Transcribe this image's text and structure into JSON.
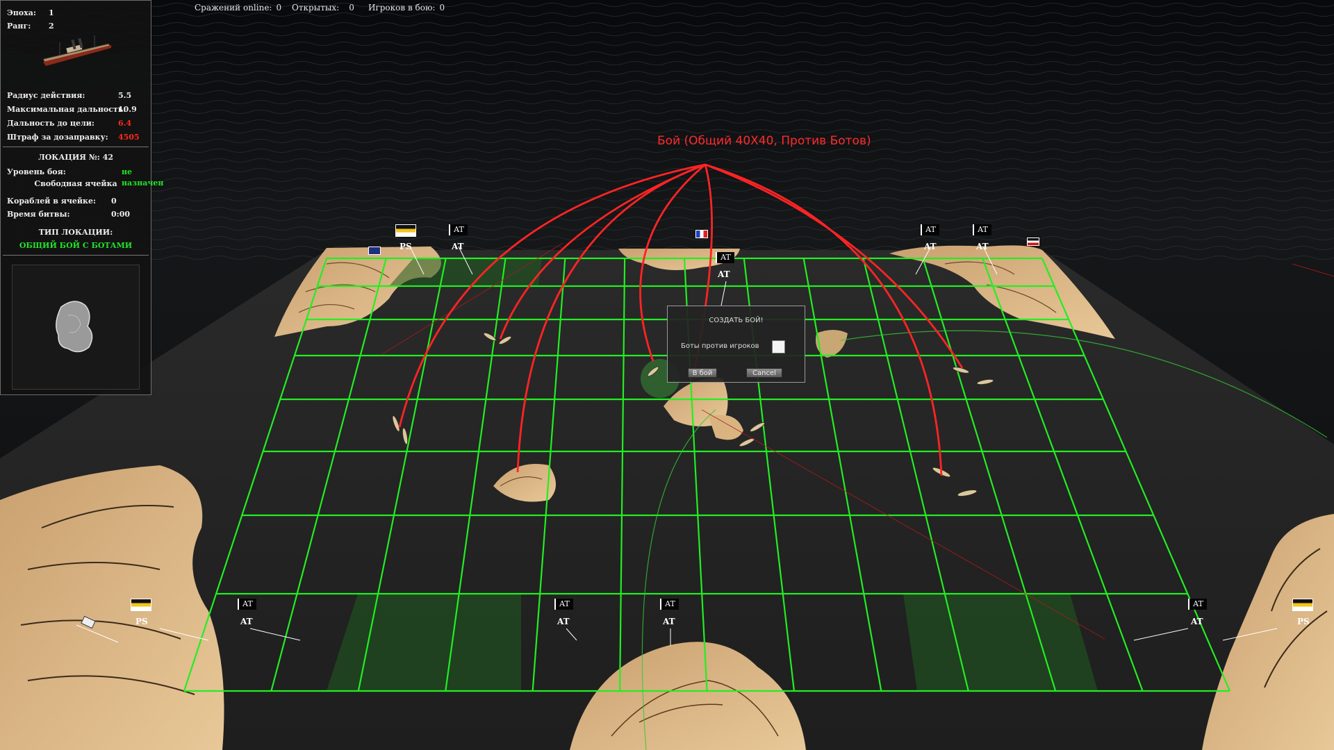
{
  "top_bar": {
    "battles_online_label": "Сражений online:",
    "battles_online_value": "0",
    "open_label": "Открытых:",
    "open_value": "0",
    "players_label": "Игроков в бою:",
    "players_value": "0"
  },
  "info_panel": {
    "era_label": "Эпоха:",
    "era_value": "1",
    "rank_label": "Ранг:",
    "rank_value": "2",
    "radius_label": "Радиус действия:",
    "radius_value": "5.5",
    "max_range_label": "Максимальная дальность:",
    "max_range_value": "10.9",
    "distance_label": "Дальность до цели:",
    "distance_value": "6.4",
    "penalty_label": "Штраф за дозаправку:",
    "penalty_value": "4505",
    "location_label": "ЛОКАЦИЯ №:",
    "location_value": "42",
    "battle_level_label": "Уровень боя:",
    "battle_level_value": "не назначен",
    "cell_status": "Свободная ячейка",
    "ships_label": "Кораблей в ячейке:",
    "ships_value": "0",
    "time_label": "Время битвы:",
    "time_value": "0:00",
    "location_type_label": "ТИП ЛОКАЦИИ:",
    "location_type_value": "ОБЩИЙ БОЙ С БОТАМИ"
  },
  "battle_label": "Бой (Общий 40Х40, Против Ботов)",
  "dialog": {
    "title": "СОЗДАТЬ БОЙ!",
    "checkbox_label": "Боты против игроков",
    "fight_button": "В бой",
    "cancel_button": "Cancel"
  },
  "map_markers": {
    "ps": "PS",
    "at": "AT"
  },
  "colors": {
    "grid": "#22ee22",
    "route": "#ff2424",
    "accent_green": "#22e32a",
    "warning_red": "#ff2a1a"
  },
  "icons": [
    "ship-icon",
    "flag-russian-empire-icon",
    "flag-france-icon",
    "flag-uk-icon",
    "flag-germany-icon",
    "island-minimap-icon"
  ]
}
